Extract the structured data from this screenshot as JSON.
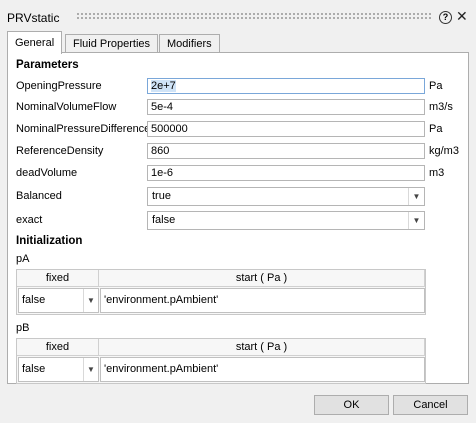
{
  "window": {
    "title": "PRVstatic"
  },
  "tabs": [
    {
      "label": "General",
      "active": true
    },
    {
      "label": "Fluid Properties",
      "active": false
    },
    {
      "label": "Modifiers",
      "active": false
    }
  ],
  "parameters": {
    "section_title": "Parameters",
    "rows": [
      {
        "label": "OpeningPressure",
        "value": "2e+7",
        "unit": "Pa"
      },
      {
        "label": "NominalVolumeFlow",
        "value": "5e-4",
        "unit": "m3/s"
      },
      {
        "label": "NominalPressureDifference",
        "value": "500000",
        "unit": "Pa"
      },
      {
        "label": "ReferenceDensity",
        "value": "860",
        "unit": "kg/m3"
      },
      {
        "label": "deadVolume",
        "value": "1e-6",
        "unit": "m3"
      }
    ],
    "balanced": {
      "label": "Balanced",
      "value": "true"
    },
    "exact": {
      "label": "exact",
      "value": "false"
    }
  },
  "initialization": {
    "section_title": "Initialization",
    "pA": {
      "label": "pA",
      "headers": {
        "fixed": "fixed",
        "start": "start ( Pa )"
      },
      "fixed_value": "false",
      "start_value": "'environment.pAmbient'"
    },
    "pB": {
      "label": "pB",
      "headers": {
        "fixed": "fixed",
        "start": "start ( Pa )"
      },
      "fixed_value": "false",
      "start_value": "'environment.pAmbient'"
    }
  },
  "buttons": {
    "ok": "OK",
    "cancel": "Cancel"
  },
  "colors": {
    "background": "#f0f0f0",
    "panel": "#ffffff",
    "selection": "#cfe3f7"
  }
}
